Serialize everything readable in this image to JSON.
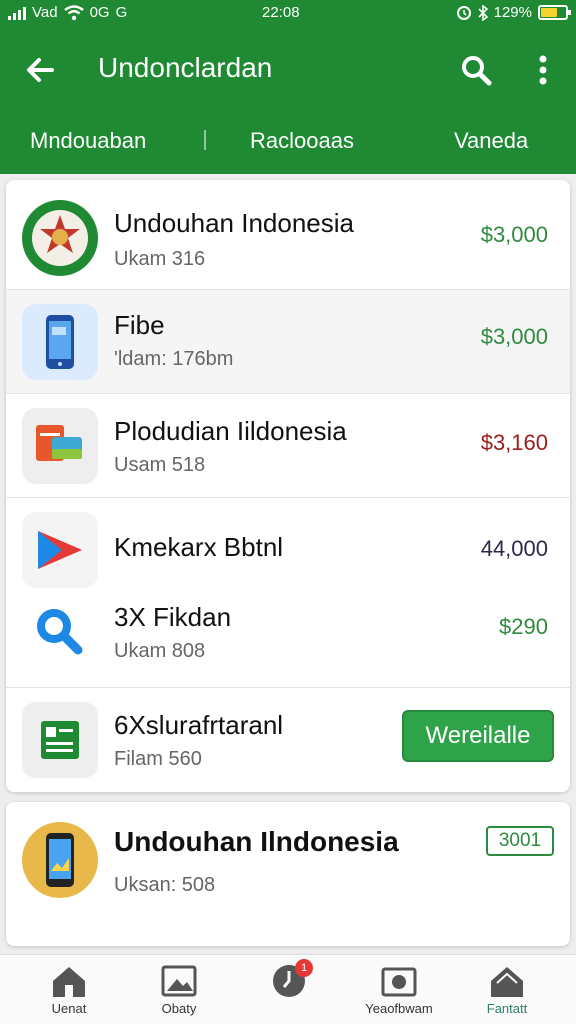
{
  "status_bar": {
    "carrier": "Vad",
    "network": "0G",
    "extra": "G",
    "time": "22:08",
    "battery": "129%",
    "battery_level": 0.6
  },
  "app_bar": {
    "title": "Undonclardan",
    "icons": [
      "arrow-back-icon",
      "search-icon",
      "more-vert-icon"
    ]
  },
  "tabs": [
    "Mndouaban",
    "Raclooaas",
    "Vaneda"
  ],
  "list": [
    {
      "title": "Undouhan Indonesia",
      "subtitle": "Ukam 316",
      "price": "$3,000",
      "price_color": "#2e8b3e",
      "icon": "emblem-icon"
    },
    {
      "title": "Fibe",
      "subtitle": "'ldam: 176bm",
      "price": "$3,000",
      "price_color": "#2e8b3e",
      "icon": "phone-app-icon"
    },
    {
      "title": "Plodudian Iildonesia",
      "subtitle": "Usam 518",
      "price": "$3,160",
      "price_color": "#9c1c1c",
      "icon": "cards-icon"
    },
    {
      "title": "Kmekarx Bbtnl",
      "subtitle": "",
      "price": "44,000",
      "price_color": "#2a2a4a",
      "icon": "play-store-icon"
    },
    {
      "title": "3X Fikdan",
      "subtitle": "Ukam 808",
      "price": "$290",
      "price_color": "#2e8b3e",
      "icon": "magnifier-icon"
    },
    {
      "title": "6Xslurafrtaranl",
      "subtitle": "Filam 560",
      "price": "",
      "price_color": "#2e8b3e",
      "icon": "document-icon",
      "button_label": "Wereilalle"
    }
  ],
  "featured": {
    "title": "Undouhan Ilndonesia",
    "subtitle": "Uksan: 508",
    "price": "3001",
    "icon": "smartphone-icon"
  },
  "bottom_nav": [
    {
      "label": "Uenat",
      "icon": "home-icon"
    },
    {
      "label": "Obaty",
      "icon": "image-icon"
    },
    {
      "label": "",
      "icon": "clock-icon",
      "badge": "1"
    },
    {
      "label": "Yeaofbwam",
      "icon": "camera-icon"
    },
    {
      "label": "Fantatt",
      "icon": "home-active-icon",
      "active": true
    }
  ],
  "colors": {
    "primary": "#1f8a33",
    "accent": "#2fa34a",
    "active_nav": "#2e7d6b"
  }
}
